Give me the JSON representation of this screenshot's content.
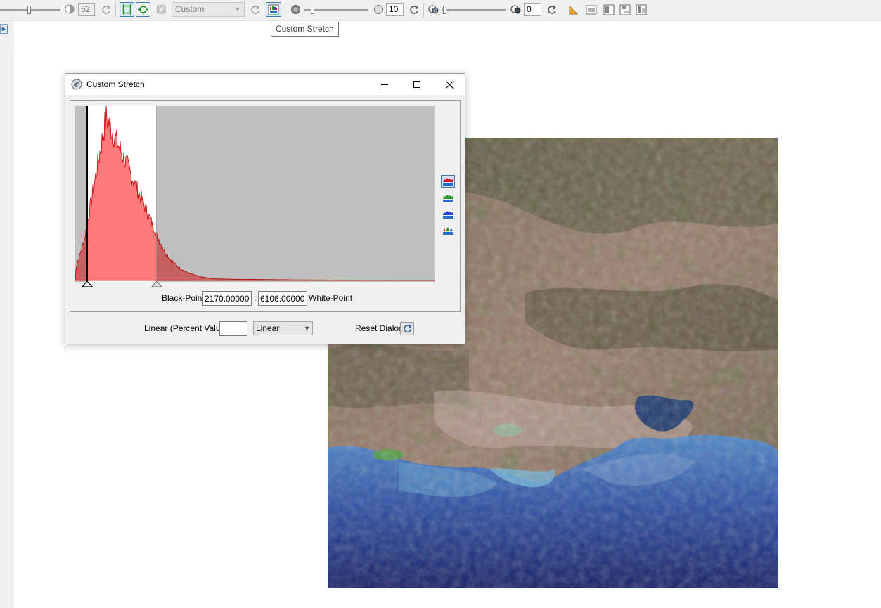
{
  "toolbar": {
    "contrast_value": "52",
    "stretch_type": "Custom",
    "gamma_value": "10",
    "transparency_value": "0"
  },
  "tooltip": {
    "text": "Custom Stretch"
  },
  "dialog": {
    "title": "Custom Stretch",
    "black_point_label": "Black-Point",
    "black_point_value": "2170.00000",
    "separator": ":",
    "white_point_value": "6106.00000",
    "white_point_label": "White-Point",
    "linear_percent_label": "Linear (Percent Value)",
    "linear_percent_value": "",
    "stretch_method": "Linear",
    "reset_label": "Reset Dialog"
  },
  "histogram": {
    "active_band": "red",
    "band_color": "#ff7b7b",
    "line_color": "#c40000"
  },
  "icons": [
    "minimize-icon",
    "maximize-icon",
    "close-icon",
    "refresh-icon",
    "custom-stretch-icon",
    "zoom-extent-icon",
    "pan-icon",
    "histogram-red-icon",
    "histogram-green-icon",
    "histogram-blue-icon",
    "histogram-rgb-icon"
  ]
}
